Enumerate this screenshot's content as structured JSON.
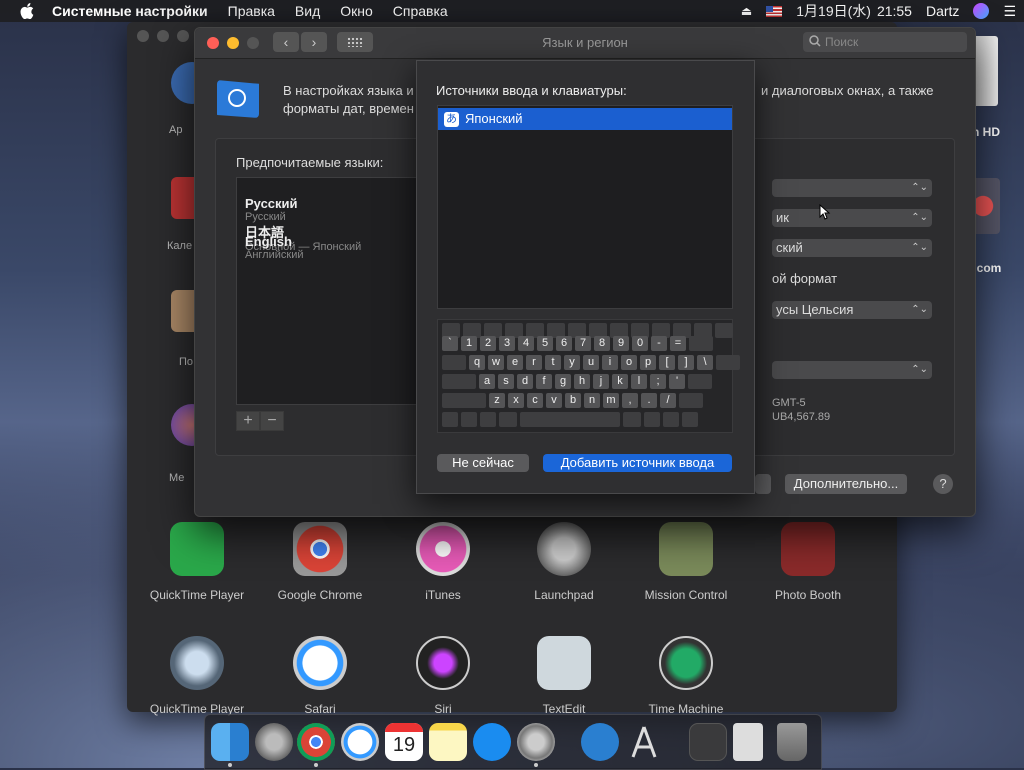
{
  "menubar": {
    "app": "Системные настройки",
    "items": [
      "Правка",
      "Вид",
      "Окно",
      "Справка"
    ],
    "date": "1月19日(水)",
    "time": "21:55",
    "user": "Dartz"
  },
  "desktop": {
    "hd_label": "n HD",
    "com_label": "n.com"
  },
  "prefs_bg": {
    "side_labels": [
      "Ар",
      "Кале",
      "По",
      "Ме"
    ],
    "apps_row1": [
      "QuickTime Player",
      "Google Chrome",
      "iTunes",
      "Launchpad",
      "Mission Control",
      "Photo Booth"
    ],
    "apps_row2": [
      "QuickTime Player",
      "Safari",
      "Siri",
      "TextEdit",
      "Time Machine"
    ]
  },
  "window": {
    "title": "Язык и регион",
    "search_placeholder": "Поиск",
    "desc_left": "В настройках языка и",
    "desc_left2": "форматы дат, времен",
    "desc_right": "и диалоговых окнах, а также",
    "preferred_label": "Предпочитаемые языки:",
    "languages": [
      {
        "name": "Русский",
        "sub": "Русский"
      },
      {
        "name": "日本語",
        "sub": "Основной — Японский"
      },
      {
        "name": "English",
        "sub": "Английский"
      }
    ],
    "right_fields": [
      "ик",
      "ский",
      "усы Цельсия"
    ],
    "format_text": "ой формат",
    "gmt": "GMT-5",
    "number": "UB4,567.89",
    "advanced_button": "Дополнительно...",
    "help": "?"
  },
  "sheet": {
    "title": "Источники ввода и клавиатуры:",
    "selected_source": "Японский",
    "source_icon": "あ",
    "cancel": "Не сейчас",
    "add": "Добавить источник ввода",
    "keys_row1": [
      "`",
      "1",
      "2",
      "3",
      "4",
      "5",
      "6",
      "7",
      "8",
      "9",
      "0",
      "-",
      "="
    ],
    "keys_row2": [
      "q",
      "w",
      "e",
      "r",
      "t",
      "y",
      "u",
      "i",
      "o",
      "p",
      "[",
      "]",
      "\\"
    ],
    "keys_row3": [
      "a",
      "s",
      "d",
      "f",
      "g",
      "h",
      "j",
      "k",
      "l",
      ";",
      "'"
    ],
    "keys_row4": [
      "z",
      "x",
      "c",
      "v",
      "b",
      "n",
      "m",
      ",",
      ".",
      "/"
    ]
  },
  "dock": {
    "calendar_day": "19"
  }
}
